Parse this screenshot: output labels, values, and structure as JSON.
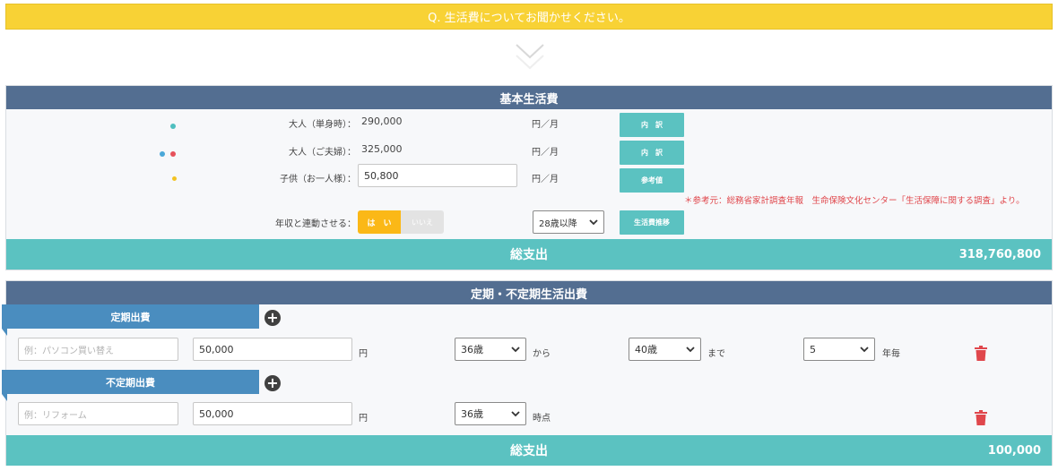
{
  "question": {
    "text": "Q. 生活費についてお聞かせください。"
  },
  "basic": {
    "title": "基本生活費",
    "rows": [
      {
        "label": "大人（単身時）：",
        "value": "290,000",
        "unit": "円／月",
        "button": "内　訳"
      },
      {
        "label": "大人（ご夫婦）：",
        "value": "325,000",
        "unit": "円／月",
        "button": "内　訳"
      },
      {
        "label": "子供（お一人様）：",
        "value": "50,800",
        "unit": "円／月",
        "button": "参考値"
      }
    ],
    "note": "＊参考元：総務省家計調査年報　生命保険文化センター「生活保障に関する調査」より。",
    "income_link": {
      "label": "年収と連動させる：",
      "yes": "は　い",
      "no": "いいえ",
      "age_select": "28歳以降",
      "button": "生活費推移"
    },
    "total": {
      "label": "総支出",
      "value": "318,760,800"
    }
  },
  "expenses": {
    "title": "定期・不定期生活出費",
    "regular": {
      "tab": "定期出費",
      "row": {
        "name_placeholder": "例：パソコン買い替え",
        "amount": "50,000",
        "amount_unit": "円",
        "from_age": "36歳",
        "from_label": "から",
        "to_age": "40歳",
        "to_label": "まで",
        "interval": "5",
        "interval_unit": "年毎"
      }
    },
    "irregular": {
      "tab": "不定期出費",
      "row": {
        "name_placeholder": "例：リフォーム",
        "amount": "50,000",
        "amount_unit": "円",
        "age": "36歳",
        "age_label": "時点"
      }
    },
    "total": {
      "label": "総支出",
      "value": "100,000"
    }
  },
  "colors": {
    "question_bar": "#f8d235",
    "panel_header": "#536e91",
    "total_bar": "#5bc2c1",
    "tab": "#4a8dbf",
    "toggle_yes": "#fbb817",
    "note": "#e0474c",
    "trash": "#e0474c",
    "dot_teal": "#4fbfbf",
    "dot_blue": "#4aa8d8",
    "dot_red": "#e6515a",
    "dot_yellow": "#f3c322"
  },
  "icons": [
    "chevron-down-icon",
    "plus-icon",
    "trash-icon",
    "select-chevron-icon"
  ]
}
